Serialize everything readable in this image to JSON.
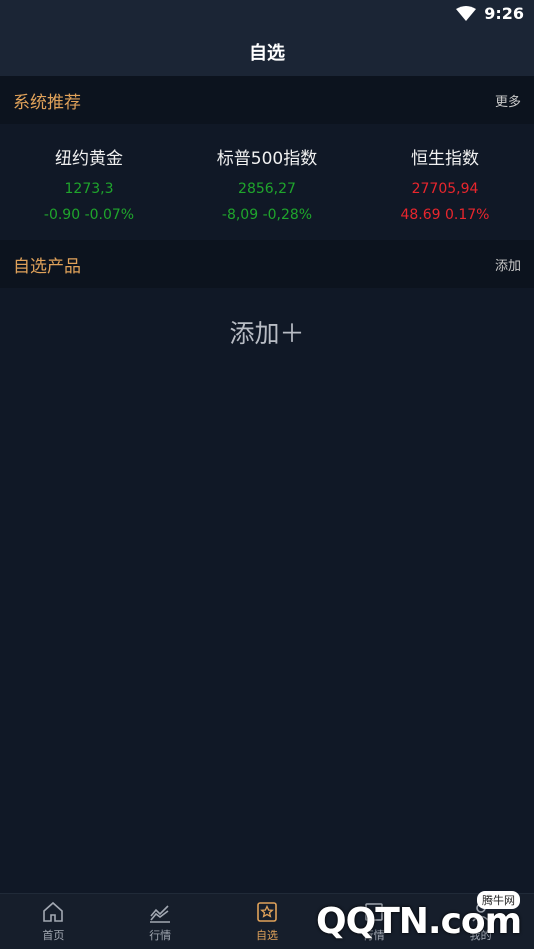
{
  "status": {
    "time": "9:26"
  },
  "header": {
    "title": "自选"
  },
  "recommend": {
    "title": "系统推荐",
    "more_label": "更多",
    "items": [
      {
        "name": "纽约黄金",
        "price": "1273,3",
        "change": "-0.90 -0.07%",
        "trend": "down"
      },
      {
        "name": "标普500指数",
        "price": "2856,27",
        "change": "-8,09 -0,28%",
        "trend": "down"
      },
      {
        "name": "恒生指数",
        "price": "27705,94",
        "change": "48.69 0.17%",
        "trend": "up"
      }
    ]
  },
  "watchlist": {
    "title": "自选产品",
    "add_label": "添加",
    "empty_prompt": "添加＋"
  },
  "tabbar": {
    "items": [
      {
        "label": "首页",
        "icon": "home-icon"
      },
      {
        "label": "行情",
        "icon": "chart-line-icon"
      },
      {
        "label": "自选",
        "icon": "star-icon",
        "active": true
      },
      {
        "label": "行情",
        "icon": "window-icon"
      },
      {
        "label": "我的",
        "icon": "user-icon"
      }
    ]
  },
  "watermark": {
    "text": "QQTN.com",
    "badge": "腾牛网"
  },
  "colors": {
    "accent": "#e0a25a",
    "down": "#1fa52c",
    "up": "#e8262d",
    "background": "#101826"
  }
}
